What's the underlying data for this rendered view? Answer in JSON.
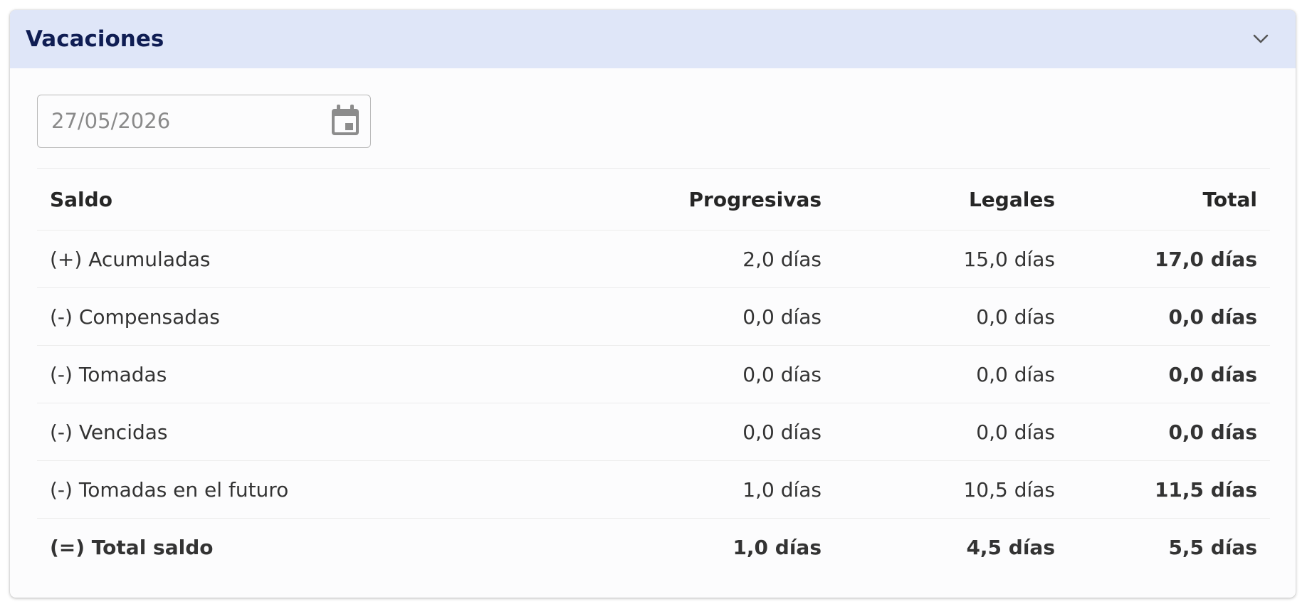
{
  "card": {
    "title": "Vacaciones",
    "toggle_icon": "chevron-down-icon"
  },
  "date_field": {
    "value": "27/05/2026",
    "icon": "calendar-icon"
  },
  "table": {
    "headers": {
      "saldo": "Saldo",
      "progresivas": "Progresivas",
      "legales": "Legales",
      "total": "Total"
    },
    "rows": [
      {
        "label": "(+) Acumuladas",
        "progresivas": "2,0 días",
        "legales": "15,0 días",
        "total": "17,0 días"
      },
      {
        "label": "(-) Compensadas",
        "progresivas": "0,0 días",
        "legales": "0,0 días",
        "total": "0,0 días"
      },
      {
        "label": "(-) Tomadas",
        "progresivas": "0,0 días",
        "legales": "0,0 días",
        "total": "0,0 días"
      },
      {
        "label": "(-) Vencidas",
        "progresivas": "0,0 días",
        "legales": "0,0 días",
        "total": "0,0 días"
      },
      {
        "label": "(-) Tomadas en el futuro",
        "progresivas": "1,0 días",
        "legales": "10,5 días",
        "total": "11,5 días"
      }
    ],
    "total_row": {
      "label": "(=) Total saldo",
      "progresivas": "1,0 días",
      "legales": "4,5 días",
      "total": "5,5 días"
    }
  },
  "colors": {
    "header_background": "#dfe6f8",
    "title_color": "#0f1d53",
    "icon_gray": "#8c8c8c"
  }
}
